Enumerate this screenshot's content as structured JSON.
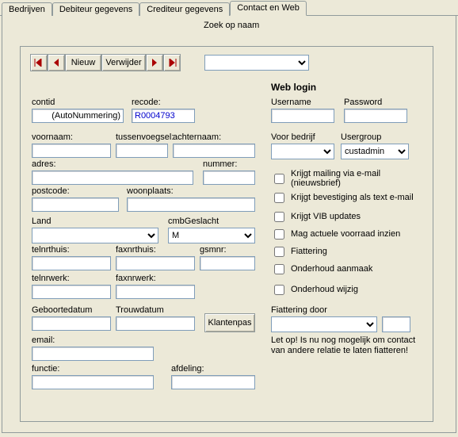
{
  "tabs": [
    "Bedrijven",
    "Debiteur gegevens",
    "Crediteur gegevens",
    "Contact en Web"
  ],
  "active_tab": 3,
  "search": {
    "label": "Zoek op naam",
    "value": ""
  },
  "nav": {
    "nieuw": "Nieuw",
    "verwijder": "Verwijder"
  },
  "left": {
    "contid": {
      "label": "contid",
      "value": "(AutoNummering)"
    },
    "recode": {
      "label": "recode:",
      "value": "R0004793"
    },
    "voornaam": {
      "label": "voornaam:",
      "value": ""
    },
    "tussenvoegsel": {
      "label": "tussenvoegsel:",
      "value": ""
    },
    "achternaam": {
      "label": "achternaam:",
      "value": ""
    },
    "adres": {
      "label": "adres:",
      "value": ""
    },
    "nummer": {
      "label": "nummer:",
      "value": ""
    },
    "postcode": {
      "label": "postcode:",
      "value": ""
    },
    "woonplaats": {
      "label": "woonplaats:",
      "value": ""
    },
    "land": {
      "label": "Land",
      "value": ""
    },
    "cmbGeslacht": {
      "label": "cmbGeslacht",
      "value": "M"
    },
    "telnrthuis": {
      "label": "telnrthuis:",
      "value": ""
    },
    "faxnrthuis": {
      "label": "faxnrthuis:",
      "value": ""
    },
    "gsmnr": {
      "label": "gsmnr:",
      "value": ""
    },
    "telnrwerk": {
      "label": "telnrwerk:",
      "value": ""
    },
    "faxnrwerk": {
      "label": "faxnrwerk:",
      "value": ""
    },
    "geboortedatum": {
      "label": "Geboortedatum",
      "value": ""
    },
    "trouwdatum": {
      "label": "Trouwdatum",
      "value": ""
    },
    "klantenpas": "Klantenpas",
    "email": {
      "label": "email:",
      "value": ""
    },
    "functie": {
      "label": "functie:",
      "value": ""
    },
    "afdeling": {
      "label": "afdeling:",
      "value": ""
    }
  },
  "right": {
    "title": "Web login",
    "username": {
      "label": "Username",
      "value": ""
    },
    "password": {
      "label": "Password",
      "value": ""
    },
    "voor_bedrijf": {
      "label": "Voor bedrijf",
      "value": ""
    },
    "usergroup": {
      "label": "Usergroup",
      "value": "custadmin"
    },
    "checks": [
      "Krijgt mailing via e-mail (nieuwsbrief)",
      "Krijgt bevestiging als text e-mail",
      "Krijgt VIB updates",
      "Mag actuele voorraad inzien",
      "Fiattering",
      "Onderhoud aanmaak",
      "Onderhoud wijzig"
    ],
    "fiattering_door": {
      "label": "Fiattering door",
      "value": "",
      "extra": ""
    },
    "note": "Let op! Is nu nog mogelijk om contact van andere relatie te laten fiatteren!"
  }
}
